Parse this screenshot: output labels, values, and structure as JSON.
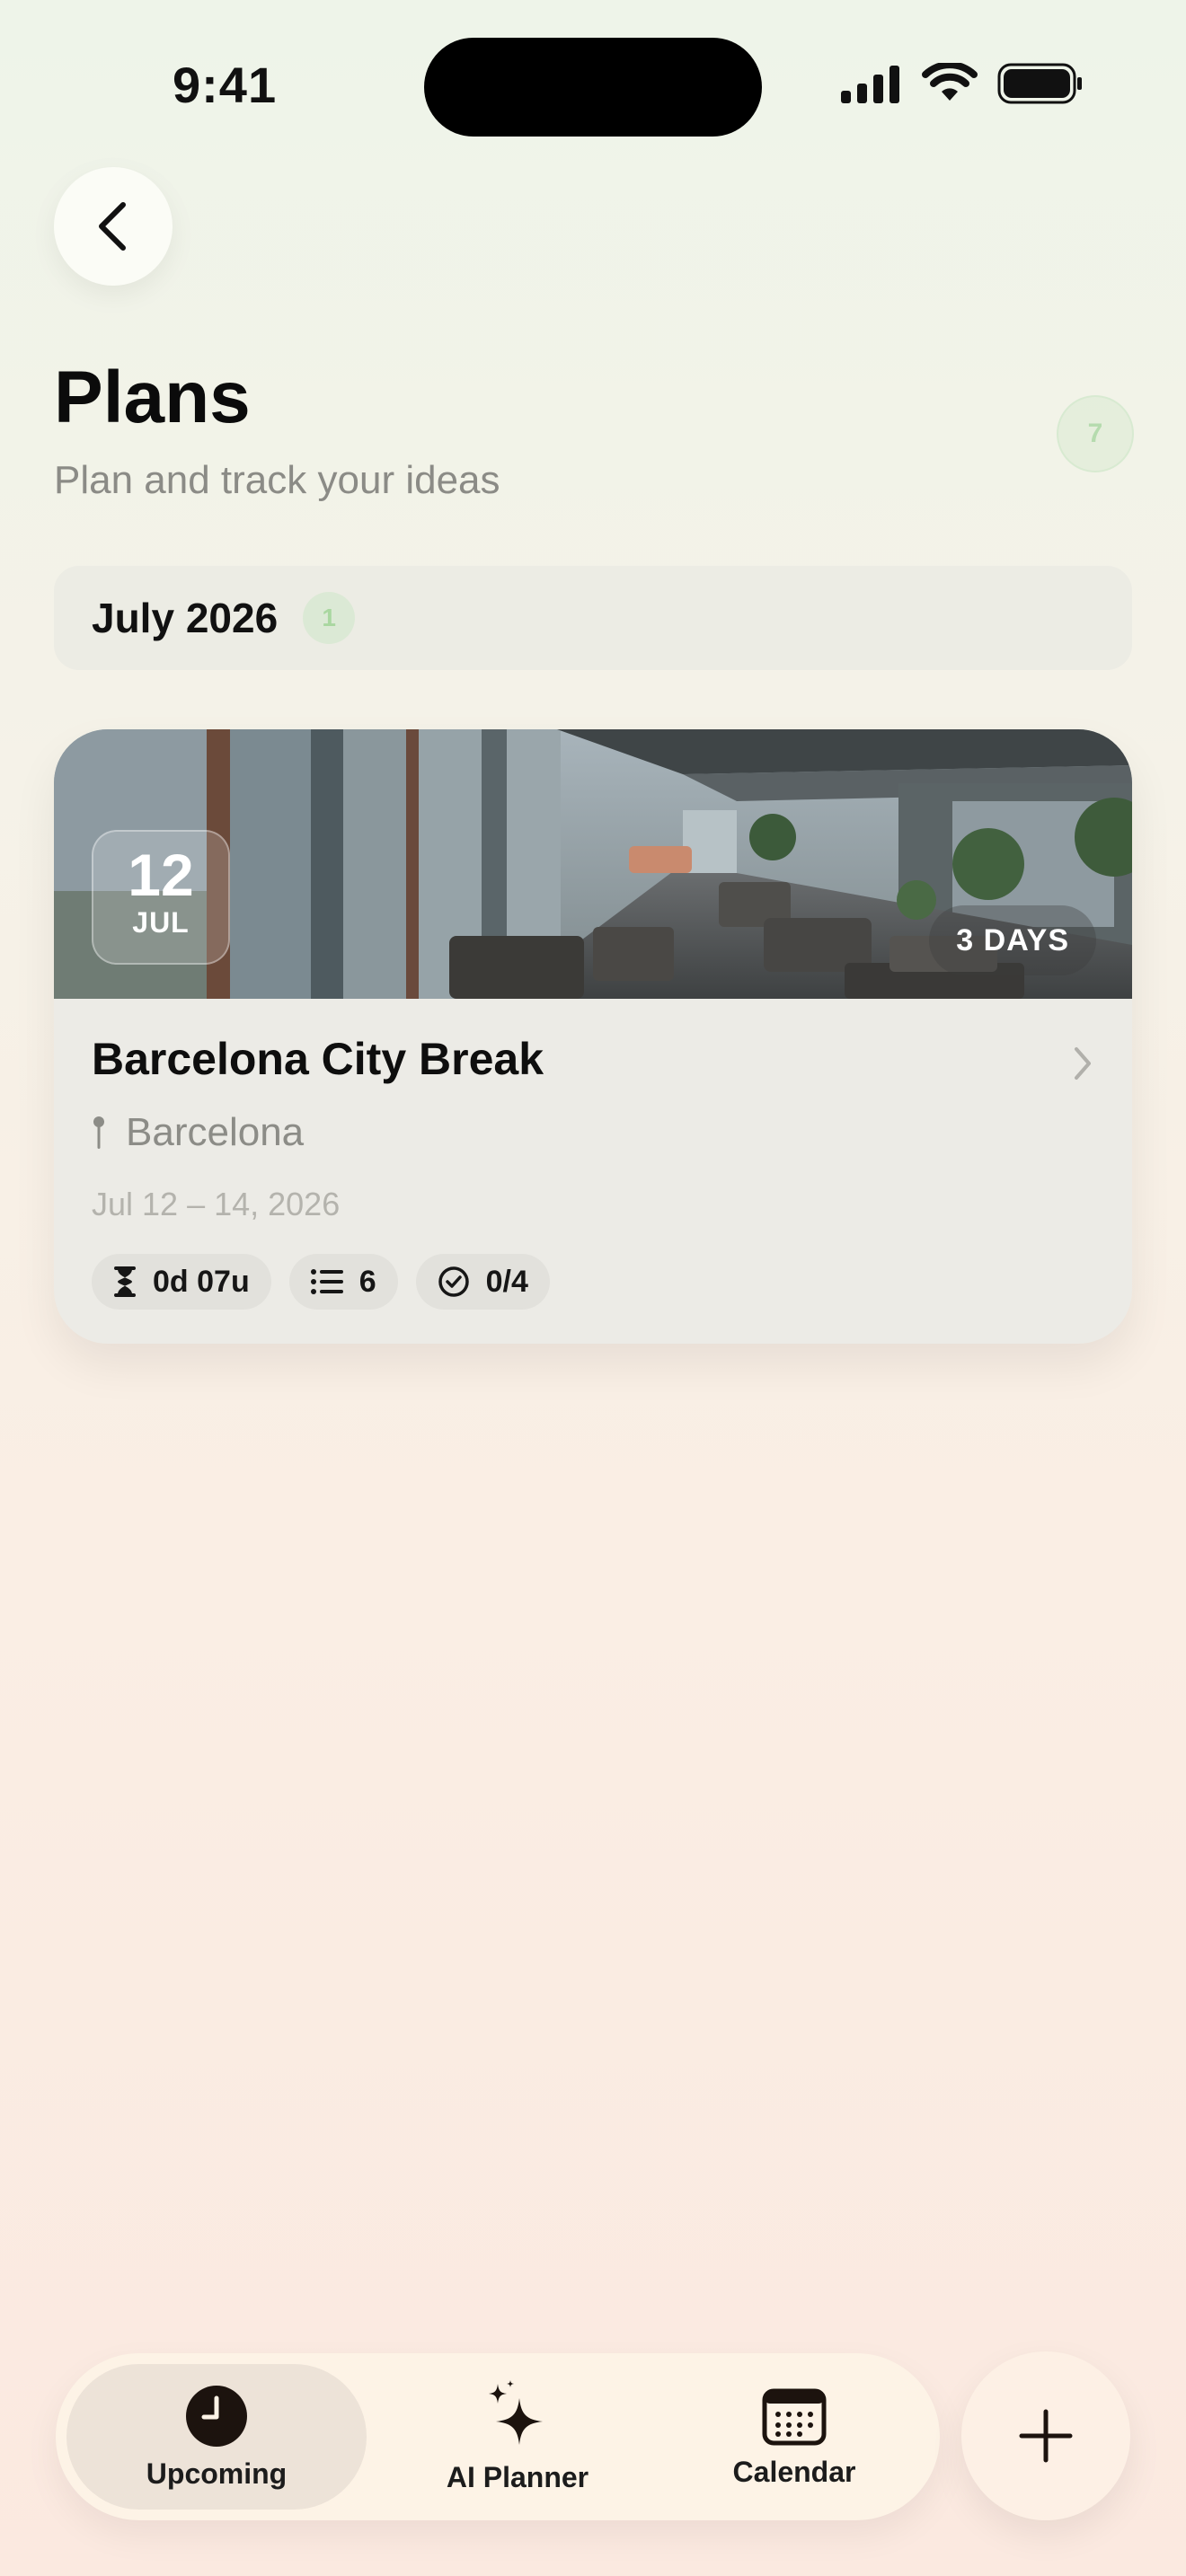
{
  "status_bar": {
    "time": "9:41"
  },
  "header": {
    "title": "Plans",
    "subtitle": "Plan and track your ideas",
    "count": "7"
  },
  "month_section": {
    "label": "July 2026",
    "count": "1"
  },
  "plan_card": {
    "day": "12",
    "month": "JUL",
    "duration": "3 DAYS",
    "title": "Barcelona City Break",
    "location": "Barcelona",
    "dates": "Jul 12 – 14, 2026",
    "chips": [
      {
        "icon": "hourglass-icon",
        "label": "0d 07u"
      },
      {
        "icon": "list-icon",
        "label": "6"
      },
      {
        "icon": "check-circle-icon",
        "label": "0/4"
      }
    ]
  },
  "tab_bar": {
    "items": [
      {
        "label": "Upcoming",
        "icon": "clock-icon",
        "active": true
      },
      {
        "label": "AI Planner",
        "icon": "sparkles-icon",
        "active": false
      },
      {
        "label": "Calendar",
        "icon": "calendar-icon",
        "active": false
      }
    ],
    "fab_icon": "plus-icon"
  }
}
